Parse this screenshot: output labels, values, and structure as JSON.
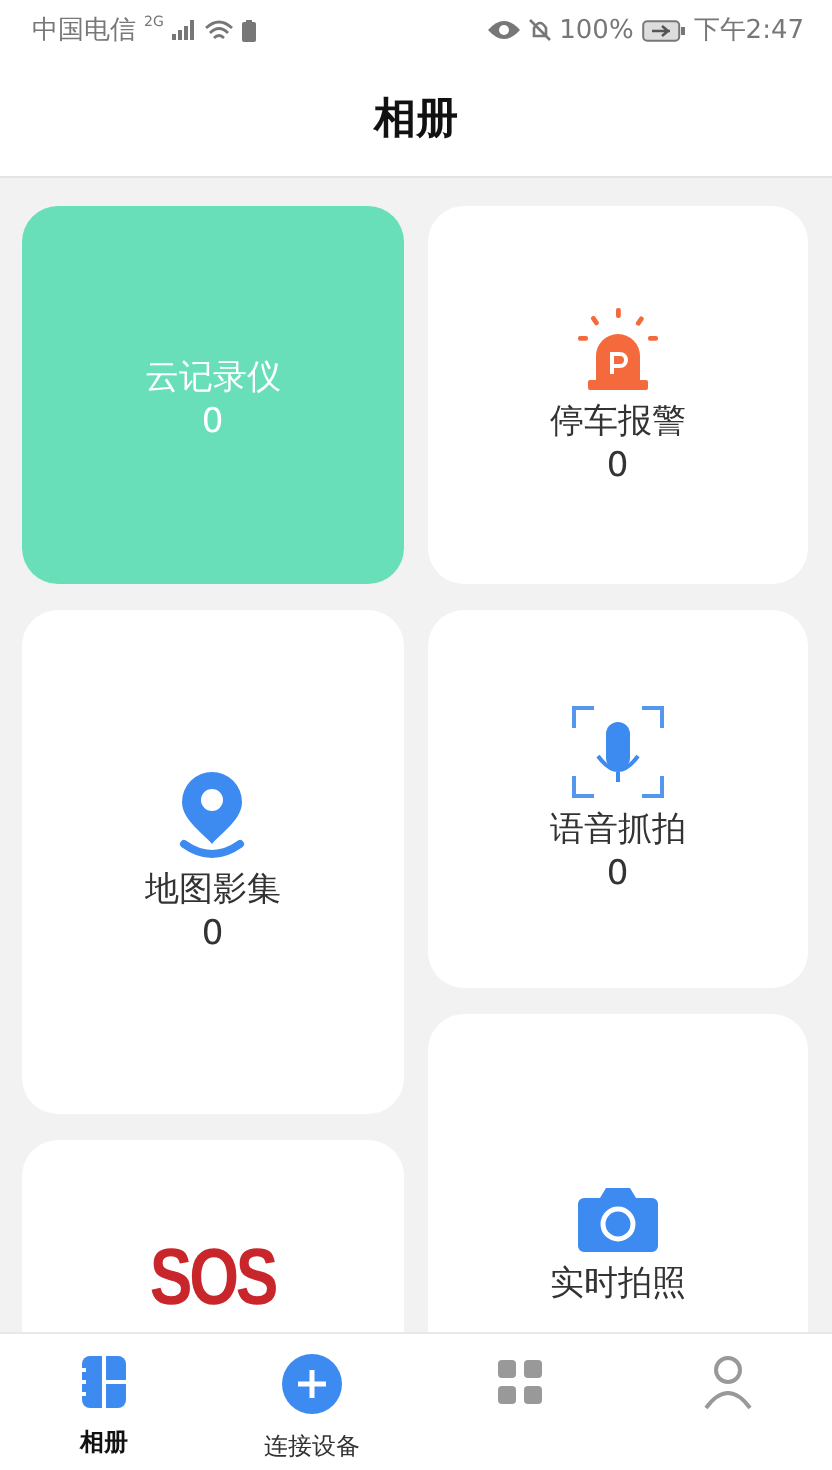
{
  "status_bar": {
    "carrier": "中国电信",
    "network": "2G",
    "battery": "100%",
    "time": "下午2:47"
  },
  "header": {
    "title": "相册"
  },
  "columns": [
    {
      "items": [
        {
          "kind": "cloud",
          "label": "云记录仪",
          "count": "0",
          "selected": true
        },
        {
          "kind": "map",
          "label": "地图影集",
          "count": "0",
          "selected": false
        },
        {
          "kind": "sos",
          "logo": "SOS",
          "selected": false
        }
      ]
    },
    {
      "items": [
        {
          "kind": "alarm",
          "label": "停车报警",
          "count": "0",
          "selected": false
        },
        {
          "kind": "voice",
          "label": "语音抓拍",
          "count": "0",
          "selected": false
        },
        {
          "kind": "camera",
          "label": "实时拍照",
          "selected": false
        }
      ]
    }
  ],
  "tab_bar": [
    {
      "kind": "album",
      "label": "相册",
      "selected": true
    },
    {
      "kind": "add",
      "label": "连接设备",
      "selected": false
    },
    {
      "kind": "other",
      "selected": false
    },
    {
      "kind": "profile",
      "selected": false
    }
  ]
}
